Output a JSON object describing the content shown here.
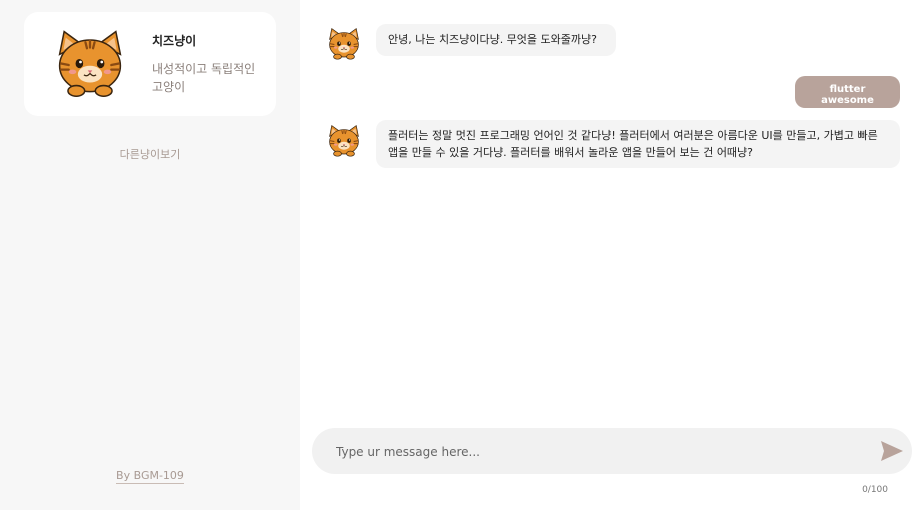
{
  "sidebar": {
    "cat_name": "치즈냥이",
    "cat_description": "내성적이고 독립적인 고양이",
    "other_cats_link": "다른냥이보기",
    "credit": "By BGM-109"
  },
  "chat": {
    "messages": [
      {
        "sender": "bot",
        "text": "안녕, 나는 치즈냥이다냥. 무엇을 도와줄까냥?"
      },
      {
        "sender": "user",
        "text": "flutter awesome"
      },
      {
        "sender": "bot",
        "text": "플러터는 정말 멋진 프로그래밍 언어인 것 같다냥! 플러터에서 여러분은 아름다운 UI를 만들고, 가볍고 빠른 앱을 만들 수 있을 거다냥. 플러터를 배워서 놀라운 앱을 만들어 보는 건 어때냥?"
      }
    ],
    "input": {
      "placeholder": "Type ur message here...",
      "value": ""
    },
    "char_counter": "0/100"
  },
  "colors": {
    "accent": "#b8a39b",
    "sidebar_bg": "#f7f7f7",
    "bubble_bg": "#f4f4f4",
    "cat_orange": "#e8932e"
  },
  "icons": {
    "avatar": "cat-face-icon",
    "send": "send-arrow-icon"
  }
}
